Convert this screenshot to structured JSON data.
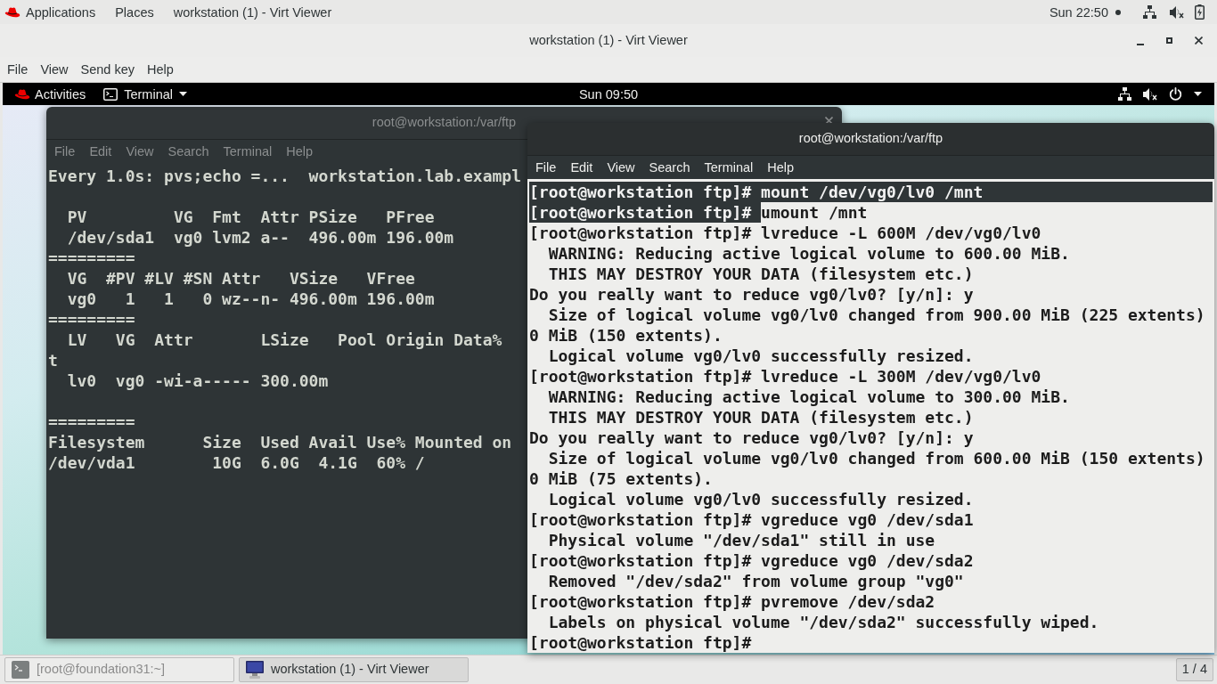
{
  "host_top_bar": {
    "menus": [
      "Applications",
      "Places"
    ],
    "app_title": "workstation (1) - Virt Viewer",
    "clock": "Sun 22:50"
  },
  "window": {
    "title": "workstation (1) - Virt Viewer"
  },
  "menu_bar": {
    "items": [
      "File",
      "View",
      "Send key",
      "Help"
    ]
  },
  "guest": {
    "top_bar": {
      "activities": "Activities",
      "app_menu": "Terminal",
      "clock": "Sun 09:50"
    },
    "back_terminal": {
      "title": "root@workstation:/var/ftp",
      "active": false,
      "menu": [
        "File",
        "Edit",
        "View",
        "Search",
        "Terminal",
        "Help"
      ],
      "blocks": [
        [
          "Every 1.0s: pvs;echo =...  workstation.lab.exampl"
        ],
        [
          "  PV         VG  Fmt  Attr PSize   PFree",
          "  /dev/sda1  vg0 lvm2 a--  496.00m 196.00m",
          "=========",
          "  VG  #PV #LV #SN Attr   VSize   VFree",
          "  vg0   1   1   0 wz--n- 496.00m 196.00m",
          "=========",
          "  LV   VG  Attr       LSize   Pool Origin Data%",
          "t",
          "  lv0  vg0 -wi-a----- 300.00m"
        ],
        [
          "=========",
          "Filesystem      Size  Used Avail Use% Mounted on",
          "/dev/vda1        10G  6.0G  4.1G  60% /"
        ]
      ]
    },
    "front_terminal": {
      "title": "root@workstation:/var/ftp",
      "active": true,
      "menu": [
        "File",
        "Edit",
        "View",
        "Search",
        "Terminal",
        "Help"
      ],
      "lines": [
        {
          "runs": [
            {
              "text": "[root@workstation ftp]# mount /dev/vg0/lv0 /mnt",
              "selected": true
            }
          ]
        },
        {
          "runs": [
            {
              "text": "[root@workstation ftp]# ",
              "selected": true
            },
            {
              "text": "umount /mnt",
              "selected": false
            }
          ]
        },
        {
          "runs": [
            {
              "text": "[root@workstation ftp]# lvreduce -L 600M /dev/vg0/lv0",
              "selected": false
            }
          ]
        },
        {
          "runs": [
            {
              "text": "  WARNING: Reducing active logical volume to 600.00 MiB.",
              "selected": false
            }
          ]
        },
        {
          "runs": [
            {
              "text": "  THIS MAY DESTROY YOUR DATA (filesystem etc.)",
              "selected": false
            }
          ]
        },
        {
          "runs": [
            {
              "text": "Do you really want to reduce vg0/lv0? [y/n]: y",
              "selected": false
            }
          ]
        },
        {
          "runs": [
            {
              "text": "  Size of logical volume vg0/lv0 changed from 900.00 MiB (225 extents)",
              "selected": false
            }
          ]
        },
        {
          "runs": [
            {
              "text": "0 MiB (150 extents).",
              "selected": false
            }
          ]
        },
        {
          "runs": [
            {
              "text": "  Logical volume vg0/lv0 successfully resized.",
              "selected": false
            }
          ]
        },
        {
          "runs": [
            {
              "text": "[root@workstation ftp]# lvreduce -L 300M /dev/vg0/lv0",
              "selected": false
            }
          ]
        },
        {
          "runs": [
            {
              "text": "  WARNING: Reducing active logical volume to 300.00 MiB.",
              "selected": false
            }
          ]
        },
        {
          "runs": [
            {
              "text": "  THIS MAY DESTROY YOUR DATA (filesystem etc.)",
              "selected": false
            }
          ]
        },
        {
          "runs": [
            {
              "text": "Do you really want to reduce vg0/lv0? [y/n]: y",
              "selected": false
            }
          ]
        },
        {
          "runs": [
            {
              "text": "  Size of logical volume vg0/lv0 changed from 600.00 MiB (150 extents)",
              "selected": false
            }
          ]
        },
        {
          "runs": [
            {
              "text": "0 MiB (75 extents).",
              "selected": false
            }
          ]
        },
        {
          "runs": [
            {
              "text": "  Logical volume vg0/lv0 successfully resized.",
              "selected": false
            }
          ]
        },
        {
          "runs": [
            {
              "text": "[root@workstation ftp]# vgreduce vg0 /dev/sda1",
              "selected": false
            }
          ]
        },
        {
          "runs": [
            {
              "text": "  Physical volume \"/dev/sda1\" still in use",
              "selected": false
            }
          ]
        },
        {
          "runs": [
            {
              "text": "[root@workstation ftp]# vgreduce vg0 /dev/sda2",
              "selected": false
            }
          ]
        },
        {
          "runs": [
            {
              "text": "  Removed \"/dev/sda2\" from volume group \"vg0\"",
              "selected": false
            }
          ]
        },
        {
          "runs": [
            {
              "text": "[root@workstation ftp]# pvremove /dev/sda2",
              "selected": false
            }
          ]
        },
        {
          "runs": [
            {
              "text": "  Labels on physical volume \"/dev/sda2\" successfully wiped.",
              "selected": false
            }
          ]
        },
        {
          "runs": [
            {
              "text": "[root@workstation ftp]#",
              "selected": false
            }
          ]
        }
      ]
    }
  },
  "taskbar": {
    "tasks": [
      {
        "label": "[root@foundation31:~]",
        "kind": "terminal",
        "selected": false
      },
      {
        "label": "workstation (1) - Virt Viewer",
        "kind": "viewer",
        "selected": true
      }
    ],
    "workspace": "1 / 4"
  }
}
